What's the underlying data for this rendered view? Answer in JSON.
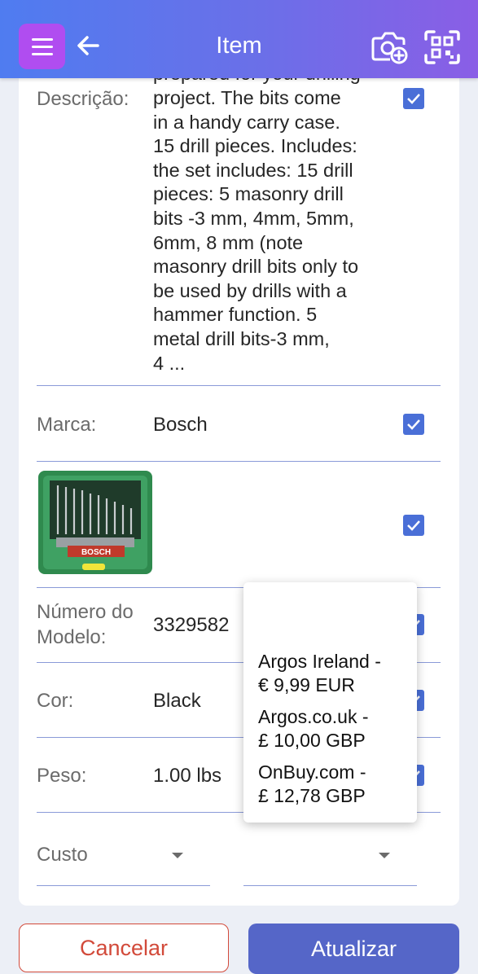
{
  "appbar": {
    "title": "Item",
    "menu_icon": "hamburger-menu-icon",
    "back_icon": "arrow-left-icon",
    "camera_icon": "camera-add-icon",
    "scan_icon": "barcode-scan-icon",
    "gradient_start": "#4f7cf0",
    "gradient_end": "#8a5ee6"
  },
  "fields": {
    "description": {
      "label": "Descrição:",
      "clipped_line": "prepared for your drilling",
      "value": "project. The bits come\nin a handy carry case.\n15 drill pieces. Includes:\nthe set includes: 15 drill\npieces: 5 masonry drill\nbits -3 mm, 4mm, 5mm,\n6mm, 8 mm (note\nmasonry drill bits only to\nbe used by drills with a\nhammer function. 5\nmetal drill bits-3 mm,\n4 ...",
      "checked": true
    },
    "brand": {
      "label": "Marca:",
      "value": "Bosch",
      "checked": true
    },
    "image": {
      "checked": true,
      "box_text": "BOSCH"
    },
    "model": {
      "label_line1": "Número do",
      "label_line2": "Modelo:",
      "value": "3329582",
      "checked": true
    },
    "color": {
      "label": "Cor:",
      "value": "Black",
      "checked": true
    },
    "weight": {
      "label": "Peso:",
      "value": "1.00 lbs",
      "checked": true
    },
    "cost": {
      "label": "Custo",
      "currency_value": ""
    }
  },
  "price_popup": {
    "items": [
      {
        "line1": "Argos Ireland -",
        "line2": "€ 9,99 EUR"
      },
      {
        "line1": "Argos.co.uk -",
        "line2": "£ 10,00 GBP"
      },
      {
        "line1": "OnBuy.com -",
        "line2": "£ 12,78 GBP"
      }
    ]
  },
  "buttons": {
    "cancel": "Cancelar",
    "update": "Atualizar"
  },
  "colors": {
    "accent": "#4a6fd7",
    "cancel": "#d24a3a",
    "update_bg": "#5566c8",
    "menu_bg": "#b04df0"
  }
}
